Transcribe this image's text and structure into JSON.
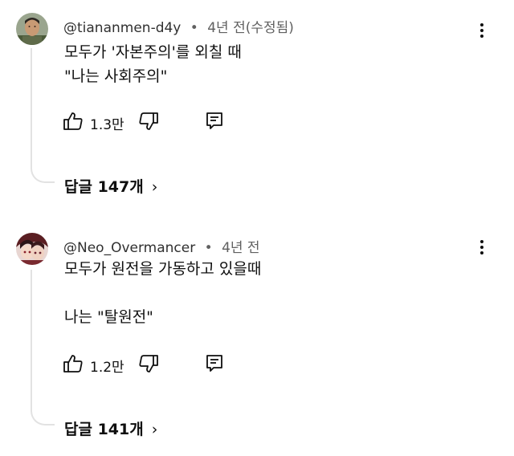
{
  "comments": [
    {
      "username": "@tiananmen-d4y",
      "separator": "•",
      "time": "4년 전(수정됨)",
      "text_lines": [
        "모두가 '자본주의'를 외칠 때",
        "\"나는 사회주의\""
      ],
      "likes": "1.3만",
      "replies_label": "답글 147개",
      "avatar_icon": "portrait-avatar-icon"
    },
    {
      "username": "@Neo_Overmancer",
      "separator": "•",
      "time": "4년 전",
      "text_lines": [
        "모두가 원전을 가동하고 있을때",
        "",
        "나는 \"탈원전\""
      ],
      "likes": "1.2만",
      "replies_label": "답글 141개",
      "avatar_icon": "anime-avatar-icon"
    }
  ],
  "icons": {
    "like": "thumb-up-icon",
    "dislike": "thumb-down-icon",
    "reply": "reply-icon",
    "more": "more-vert-icon",
    "chevron": "›"
  }
}
